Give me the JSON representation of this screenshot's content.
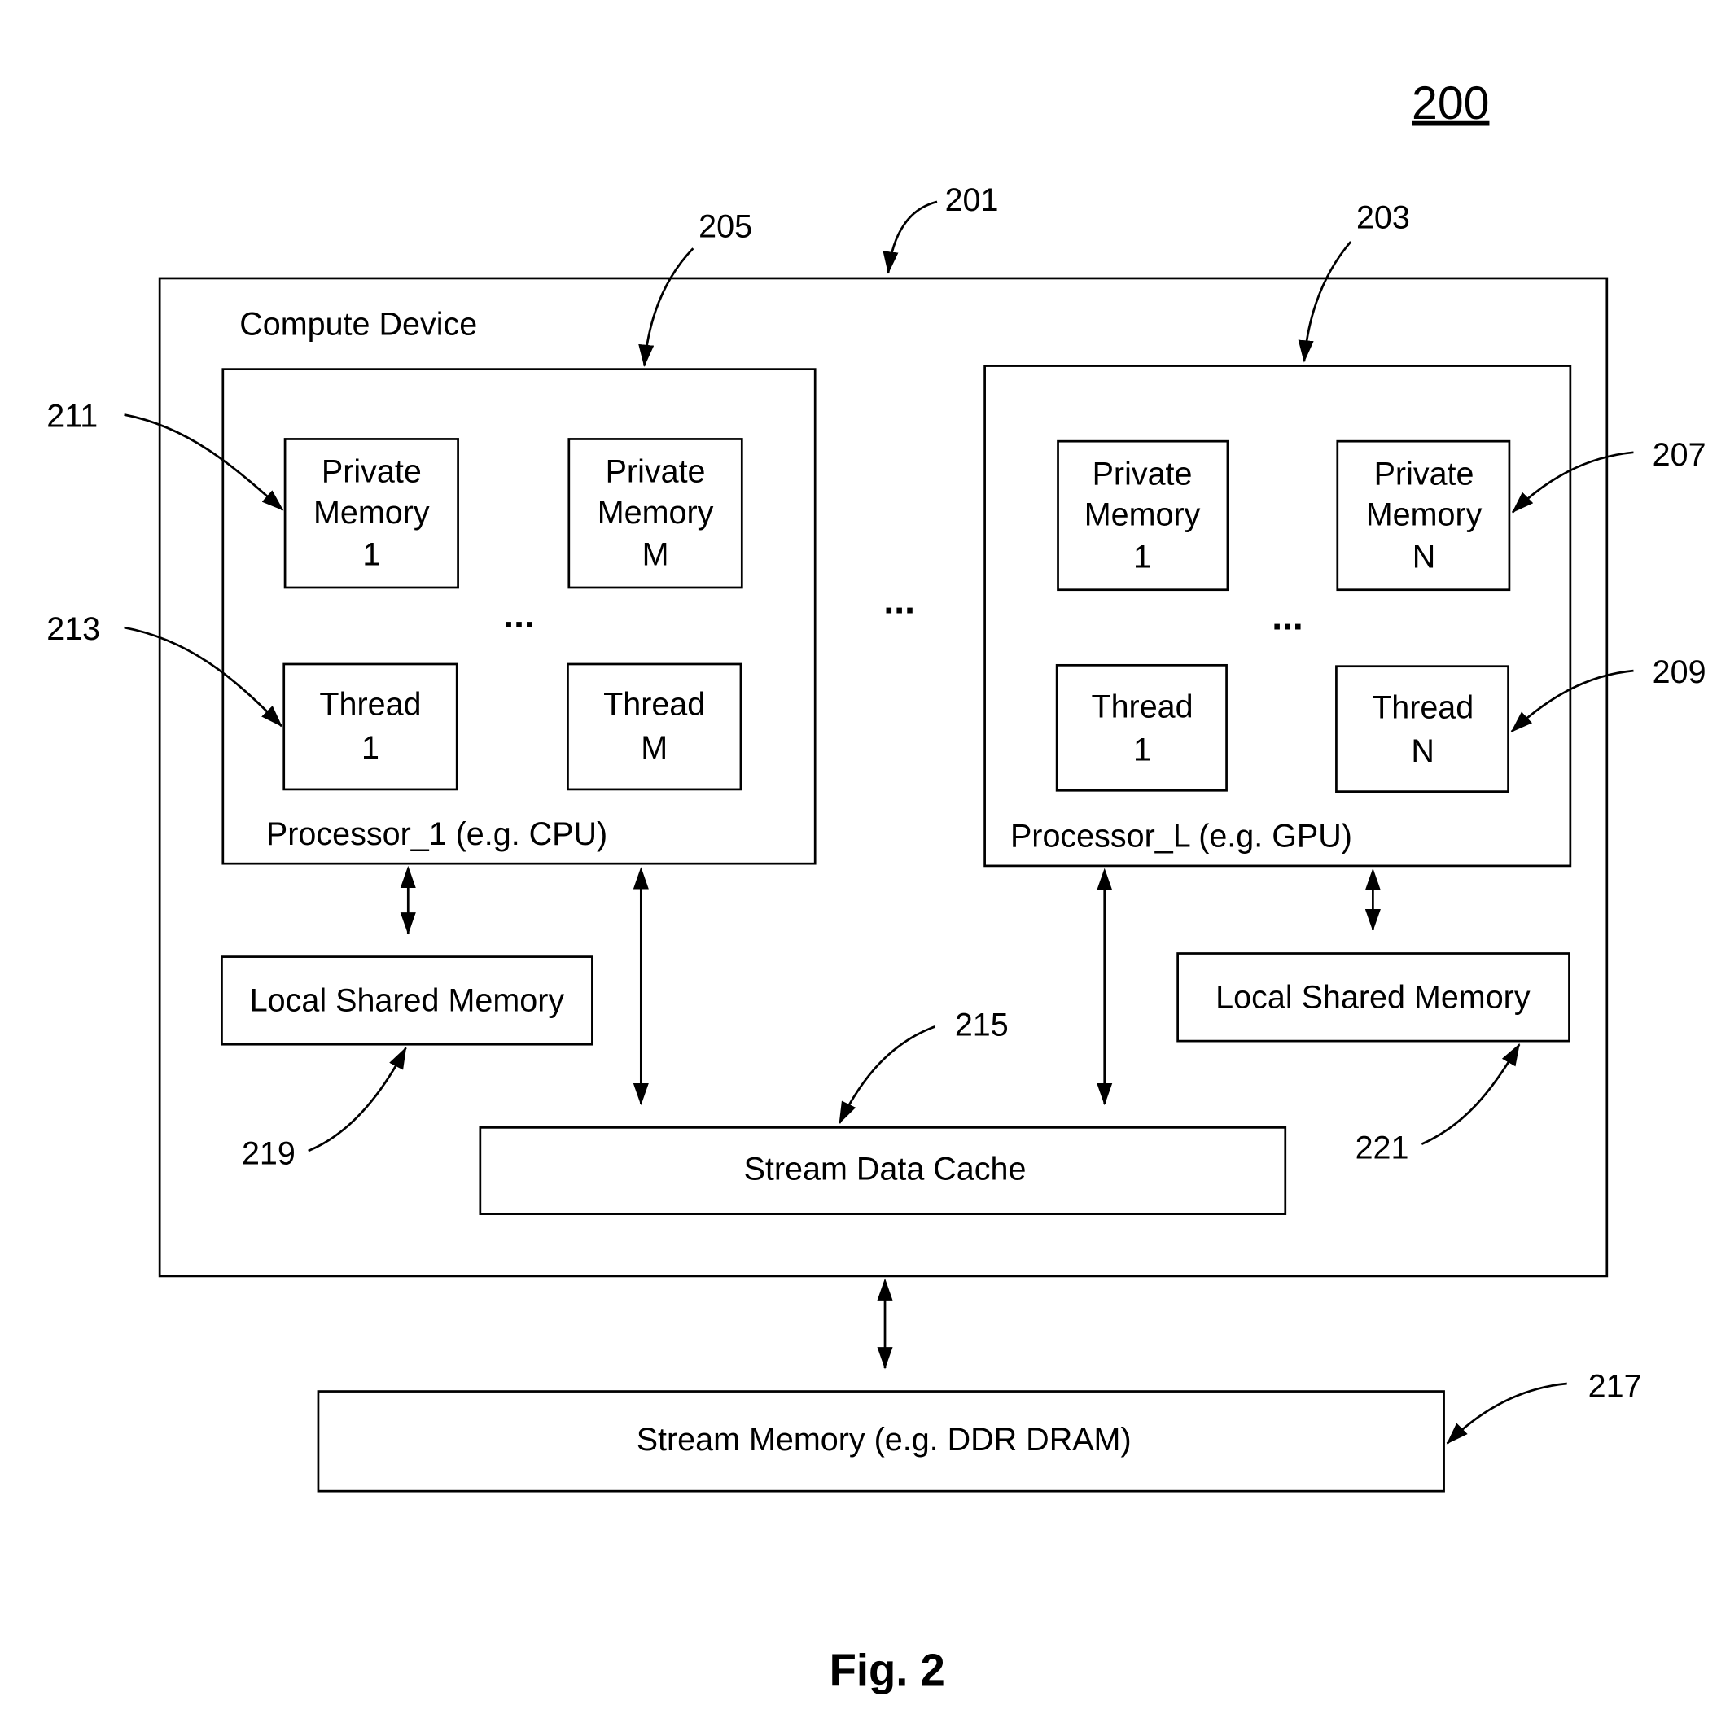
{
  "figure": {
    "number": "200",
    "caption": "Fig. 2"
  },
  "compute_device": {
    "ref": "201",
    "label": "Compute Device"
  },
  "processor_1": {
    "ref": "205",
    "label": "Processor_1 (e.g. CPU)",
    "private_memory_1": [
      "Private",
      "Memory",
      "1"
    ],
    "private_memory_m": [
      "Private",
      "Memory",
      "M"
    ],
    "thread_1": [
      "Thread",
      "1"
    ],
    "thread_m": [
      "Thread",
      "M"
    ],
    "ellipsis": "..."
  },
  "processor_l": {
    "ref": "203",
    "label": "Processor_L (e.g. GPU)",
    "private_memory_1": [
      "Private",
      "Memory",
      "1"
    ],
    "private_memory_n": [
      "Private",
      "Memory",
      "N"
    ],
    "thread_1": [
      "Thread",
      "1"
    ],
    "thread_n": [
      "Thread",
      "N"
    ],
    "ellipsis": "..."
  },
  "between_processors_ellipsis": "...",
  "refs": {
    "private_memory": "211",
    "thread": "213",
    "private_memory_n": "207",
    "thread_n": "209",
    "stream_data_cache": "215",
    "stream_memory": "217",
    "local_shared_memory_1": "219",
    "local_shared_memory_l": "221"
  },
  "local_shared_memory_1": {
    "label": "Local Shared Memory"
  },
  "local_shared_memory_l": {
    "label": "Local Shared Memory"
  },
  "stream_data_cache": {
    "label": "Stream Data Cache"
  },
  "stream_memory": {
    "label": "Stream Memory (e.g. DDR DRAM)"
  }
}
